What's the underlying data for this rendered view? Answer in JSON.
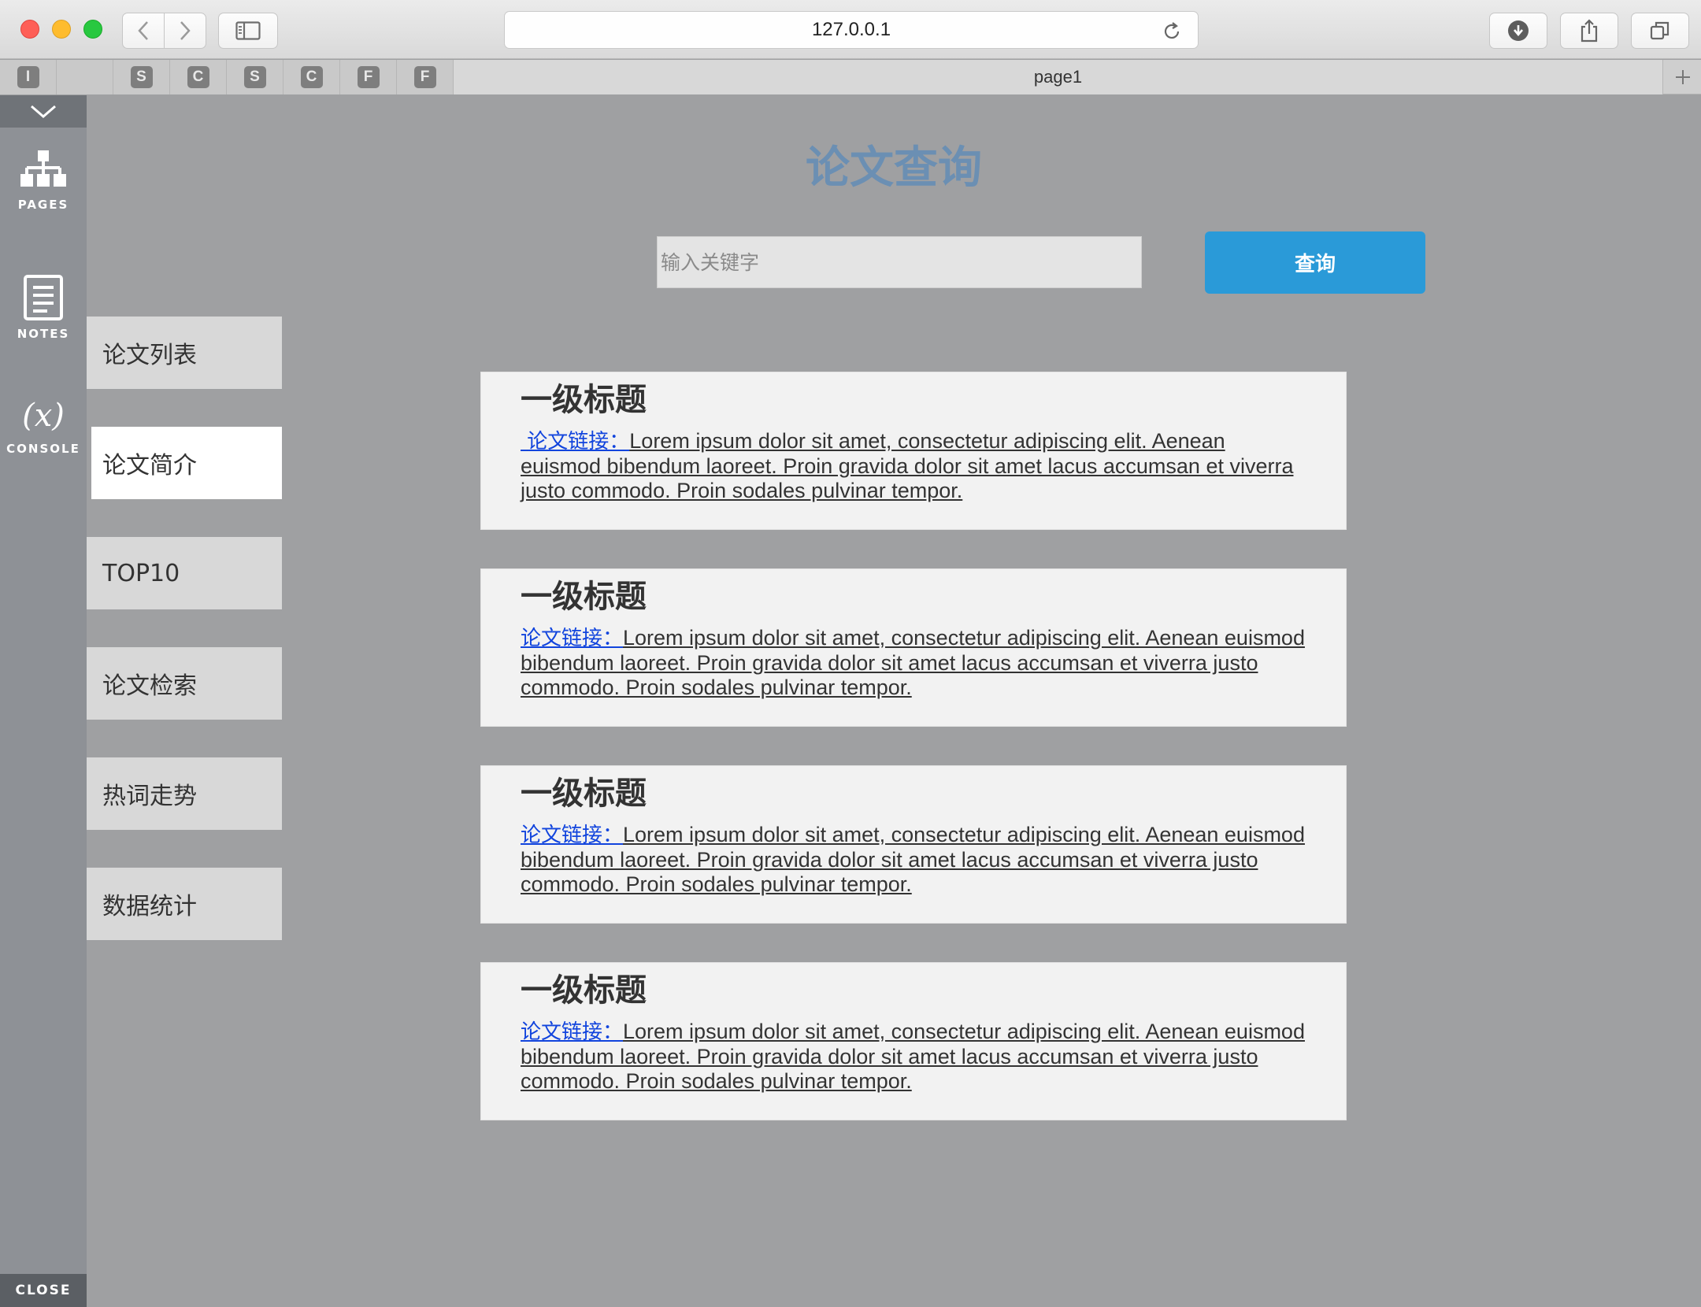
{
  "browser": {
    "url": "127.0.0.1",
    "pinned_tabs": [
      "I",
      "",
      "S",
      "C",
      "S",
      "C",
      "F",
      "F"
    ],
    "active_tab": "page1",
    "new_tab_label": "+"
  },
  "rail": {
    "pages_label": "PAGES",
    "notes_label": "NOTES",
    "console_label": "CONSOLE",
    "console_glyph": "(x)",
    "close_label": "CLOSE"
  },
  "page": {
    "title": "论文查询",
    "search": {
      "placeholder": "输入关键字",
      "value": "",
      "button_label": "查询"
    },
    "nav": [
      {
        "label": "论文列表",
        "active": false
      },
      {
        "label": "论文简介",
        "active": true
      },
      {
        "label": "TOP10",
        "active": false
      },
      {
        "label": "论文检索",
        "active": false
      },
      {
        "label": "热词走势",
        "active": false
      },
      {
        "label": "数据统计",
        "active": false
      }
    ],
    "results": [
      {
        "title": "一级标题",
        "link_label": "论文链接：",
        "lead_space": " ",
        "snippet": "Lorem ipsum dolor sit amet, consectetur adipiscing elit. Aenean euismod bibendum laoreet. Proin gravida dolor sit amet lacus accumsan et viverra justo commodo. Proin sodales pulvinar tempor."
      },
      {
        "title": "一级标题",
        "link_label": "论文链接：",
        "lead_space": "",
        "snippet": "Lorem ipsum dolor sit amet, consectetur adipiscing elit. Aenean euismod bibendum laoreet. Proin gravida dolor sit amet lacus accumsan et viverra justo commodo. Proin sodales pulvinar tempor."
      },
      {
        "title": "一级标题",
        "link_label": "论文链接：",
        "lead_space": "",
        "snippet": "Lorem ipsum dolor sit amet, consectetur adipiscing elit. Aenean euismod bibendum laoreet. Proin gravida dolor sit amet lacus accumsan et viverra justo commodo. Proin sodales pulvinar tempor."
      },
      {
        "title": "一级标题",
        "link_label": "论文链接：",
        "lead_space": "",
        "snippet": "Lorem ipsum dolor sit amet, consectetur adipiscing elit. Aenean euismod bibendum laoreet. Proin gravida dolor sit amet lacus accumsan et viverra justo commodo. Proin sodales pulvinar tempor."
      }
    ]
  },
  "colors": {
    "title": "#6b8fb3",
    "button": "#2a9ad8",
    "link": "#1144dd",
    "background": "#9fa0a2"
  }
}
